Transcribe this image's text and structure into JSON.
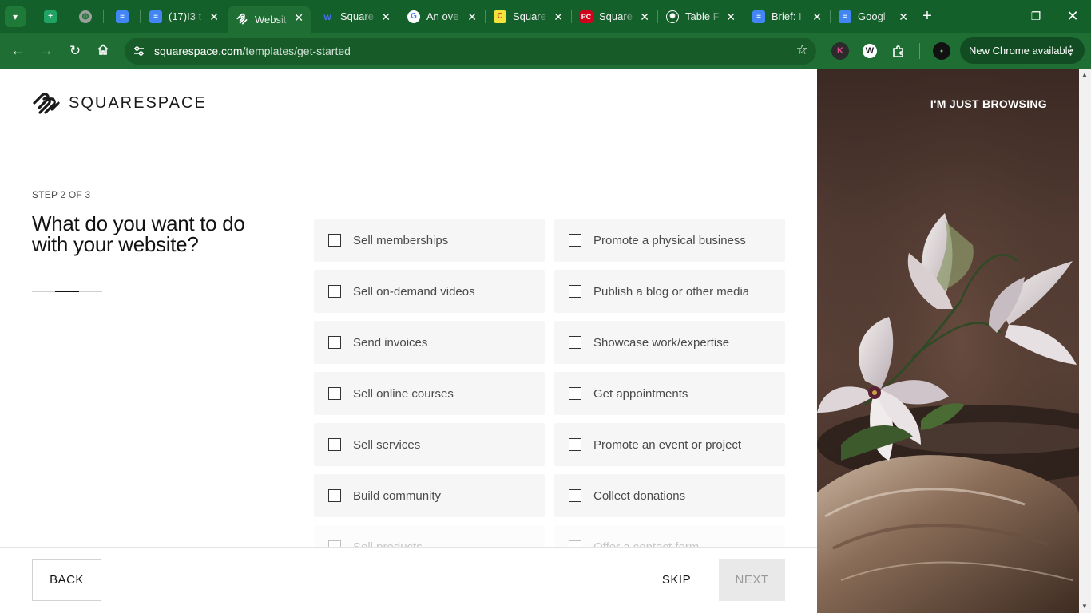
{
  "browser": {
    "tabs": [
      {
        "title": "",
        "icon": "google-sheets-icon",
        "pinned": true
      },
      {
        "title": "",
        "icon": "globe-icon",
        "pinned": true
      },
      {
        "title": "",
        "icon": "google-docs-icon",
        "pinned": true
      },
      {
        "title": "(17)I3 t",
        "icon": "google-docs-icon"
      },
      {
        "title": "Websit",
        "icon": "squarespace-icon",
        "active": true
      },
      {
        "title": "Square",
        "icon": "wix-icon"
      },
      {
        "title": "An ove",
        "icon": "google-icon"
      },
      {
        "title": "Square",
        "icon": "c-icon"
      },
      {
        "title": "Square",
        "icon": "pcmag-icon"
      },
      {
        "title": "Table F",
        "icon": "openai-icon"
      },
      {
        "title": "Brief: I",
        "icon": "google-docs-icon"
      },
      {
        "title": "Googl",
        "icon": "google-docs-icon"
      }
    ],
    "url_host": "squarespace.com",
    "url_path": "/templates/get-started",
    "update_label": "New Chrome available",
    "extensions": [
      "K",
      "W"
    ]
  },
  "brand": {
    "name": "SQUARESPACE"
  },
  "onboarding": {
    "step_label": "STEP 2 OF 3",
    "question": "What do you want to do with your website?",
    "progress": {
      "current": 2,
      "total": 3
    },
    "options_left": [
      {
        "label": "Sell memberships",
        "checked": false
      },
      {
        "label": "Sell on-demand videos",
        "checked": false
      },
      {
        "label": "Send invoices",
        "checked": false
      },
      {
        "label": "Sell online courses",
        "checked": false
      },
      {
        "label": "Sell services",
        "checked": false
      },
      {
        "label": "Build community",
        "checked": false
      },
      {
        "label": "Sell products",
        "checked": false
      }
    ],
    "options_right": [
      {
        "label": "Promote a physical business",
        "checked": false
      },
      {
        "label": "Publish a blog or other media",
        "checked": false
      },
      {
        "label": "Showcase work/expertise",
        "checked": false
      },
      {
        "label": "Get appointments",
        "checked": false
      },
      {
        "label": "Promote an event or project",
        "checked": false
      },
      {
        "label": "Collect donations",
        "checked": false
      },
      {
        "label": "Offer a contact form",
        "checked": false
      }
    ]
  },
  "footer": {
    "back_label": "BACK",
    "skip_label": "SKIP",
    "next_label": "NEXT"
  },
  "sidebar": {
    "browse_label": "I'M JUST BROWSING"
  },
  "colors": {
    "chrome_frame": "#14602b",
    "chrome_toolbar": "#1f6f34",
    "option_bg": "#f6f6f6",
    "next_disabled_bg": "#e9e9e9",
    "image_panel": "#523b33"
  }
}
